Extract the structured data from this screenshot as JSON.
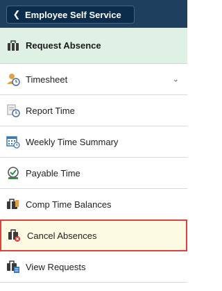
{
  "header": {
    "back_label": "Employee Self Service"
  },
  "nav": {
    "items": [
      {
        "label": "Request Absence",
        "icon": "briefcase-icon",
        "active": true
      },
      {
        "label": "Timesheet",
        "icon": "timesheet-icon",
        "expandable": true
      },
      {
        "label": "Report Time",
        "icon": "report-time-icon"
      },
      {
        "label": "Weekly Time Summary",
        "icon": "calendar-clock-icon"
      },
      {
        "label": "Payable Time",
        "icon": "payable-time-icon"
      },
      {
        "label": "Comp Time Balances",
        "icon": "comp-time-icon"
      },
      {
        "label": "Cancel Absences",
        "icon": "cancel-absence-icon",
        "highlighted": true
      },
      {
        "label": "View Requests",
        "icon": "view-requests-icon"
      }
    ]
  },
  "colors": {
    "header": "#1f3f5f",
    "active_bg": "#dff1e4",
    "highlight_border": "#e0413c",
    "highlight_bg": "#fdfae3"
  }
}
